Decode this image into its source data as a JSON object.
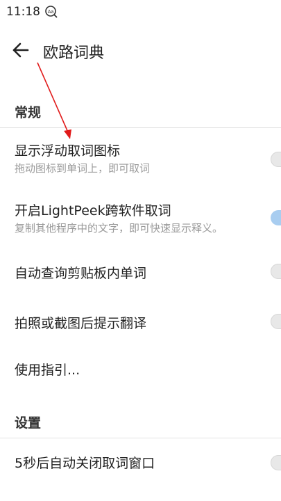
{
  "status_bar": {
    "time": "11:18",
    "notification_icon": "text-scan-icon"
  },
  "app_bar": {
    "back_icon": "arrow-left-icon",
    "title": "欧路词典"
  },
  "sections": {
    "general": "常规",
    "settings": "设置"
  },
  "items": {
    "floating_icon": {
      "title": "显示浮动取词图标",
      "subtitle": "拖动图标到单词上，即可取词",
      "enabled": false
    },
    "lightpeek": {
      "title": "开启LightPeek跨软件取词",
      "subtitle": "复制其他程序中的文字，即可快速显示释义。",
      "enabled": true
    },
    "clipboard": {
      "title": "自动查询剪贴板内单词",
      "enabled": false
    },
    "screenshot": {
      "title": "拍照或截图后提示翻译",
      "enabled": false
    },
    "guide": {
      "title": "使用指引..."
    },
    "auto_close": {
      "title": "5秒后自动关闭取词窗口",
      "enabled": false
    }
  },
  "colors": {
    "annotation_arrow": "#e11b1b",
    "toggle_on": "#a8cdf0",
    "toggle_off": "#e8e8e8"
  }
}
